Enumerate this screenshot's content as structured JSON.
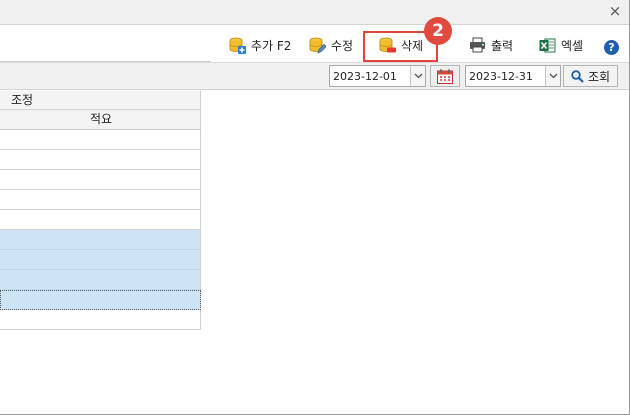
{
  "window": {
    "close_glyph": "×"
  },
  "toolbar": {
    "add_label": "추가 F2",
    "edit_label": "수정",
    "delete_label": "삭제",
    "print_label": "출력",
    "excel_label": "엑셀",
    "help_glyph": "?"
  },
  "annotation": {
    "step_number": "2",
    "highlight_color": "#e0453a"
  },
  "filter": {
    "start_date": "2023-12-01",
    "end_date": "2023-12-31",
    "search_label": "조회"
  },
  "grid": {
    "group_header": "조정",
    "column_header": "적요",
    "rows": [
      {
        "selected": false
      },
      {
        "selected": false
      },
      {
        "selected": false
      },
      {
        "selected": false
      },
      {
        "selected": false
      },
      {
        "selected": true
      },
      {
        "selected": true
      },
      {
        "selected": true
      },
      {
        "selected": true,
        "focused": true
      },
      {
        "selected": false
      }
    ]
  }
}
